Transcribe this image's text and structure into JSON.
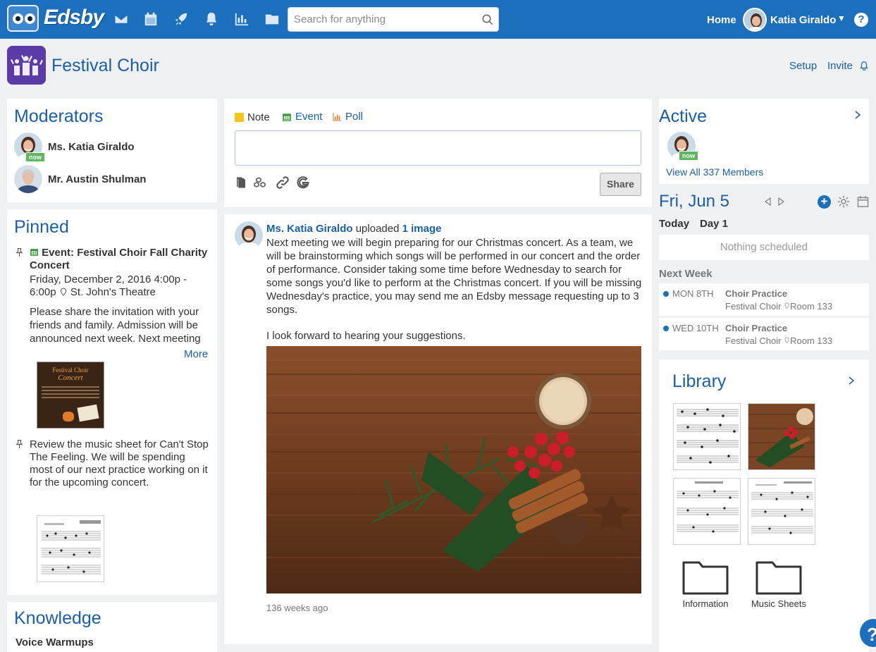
{
  "app": {
    "name": "Edsby"
  },
  "topbar": {
    "search_placeholder": "Search for anything",
    "home_label": "Home",
    "user_name": "Katia Giraldo",
    "nav_icons": [
      "mail-icon",
      "calendar-icon",
      "rocket-icon",
      "bell-icon",
      "chart-icon",
      "folder-icon"
    ]
  },
  "header": {
    "group_title": "Festival Choir",
    "setup_label": "Setup",
    "invite_label": "Invite"
  },
  "moderators": {
    "title": "Moderators",
    "items": [
      {
        "name": "Ms. Katia Giraldo",
        "status": "now"
      },
      {
        "name": "Mr. Austin Shulman"
      }
    ]
  },
  "pinned": {
    "title": "Pinned",
    "event_prefix": "Event:",
    "event_title": "Festival Choir Fall Charity Concert",
    "event_when": "Friday, December 2, 2016 4:00p - 6:00p",
    "event_where": "St. John's Theatre",
    "event_desc": "Please share the invitation with your friends and family. Admission will be announced next week. Next meeting",
    "more_label": "More",
    "poster_title": "Festival Choir",
    "poster_subtitle": "Concert",
    "note_text": "Review the music sheet for Can't Stop The Feeling. We will be spending most of our next practice working on it for the upcoming concert."
  },
  "knowledge": {
    "title": "Knowledge",
    "first_item": "Voice Warmups"
  },
  "composer": {
    "tabs": [
      {
        "label": "Note"
      },
      {
        "label": "Event"
      },
      {
        "label": "Poll"
      }
    ],
    "share_label": "Share"
  },
  "post": {
    "author": "Ms. Katia Giraldo",
    "verb": "uploaded",
    "attachment": "1 image",
    "body": "Next meeting we will begin preparing for our Christmas concert. As a team, we will be brainstorming which songs will be performed in our concert and the order of performance. Consider taking some time before Wednesday to search for some songs you'd like to perform at the Christmas concert. If you will be missing Wednesday's practice, you may send me an Edsby message requesting up to 3 songs.",
    "closing": "I look forward to hearing your suggestions.",
    "time_ago": "136 weeks ago"
  },
  "active": {
    "title": "Active",
    "status": "now",
    "view_all": "View All 337 Members"
  },
  "calendar": {
    "date": "Fri, Jun 5",
    "today_label": "Today",
    "day_label": "Day 1",
    "nothing": "Nothing scheduled",
    "next_week_label": "Next Week",
    "events": [
      {
        "day": "MON 8TH",
        "title": "Choir Practice",
        "group": "Festival Choir",
        "room": "Room 133",
        "dot": "#1c6fbd"
      },
      {
        "day": "WED 10TH",
        "title": "Choir Practice",
        "group": "Festival Choir",
        "room": "Room 133",
        "dot": "#1c6fbd"
      }
    ]
  },
  "library": {
    "title": "Library",
    "folders": [
      {
        "label": "Information"
      },
      {
        "label": "Music Sheets"
      }
    ]
  },
  "colors": {
    "brand": "#1c6fbd",
    "link": "#1a5fa8",
    "online": "#5cb85c",
    "note": "#f5c518",
    "event": "#3a9a3a",
    "poll": "#e07b2a"
  }
}
